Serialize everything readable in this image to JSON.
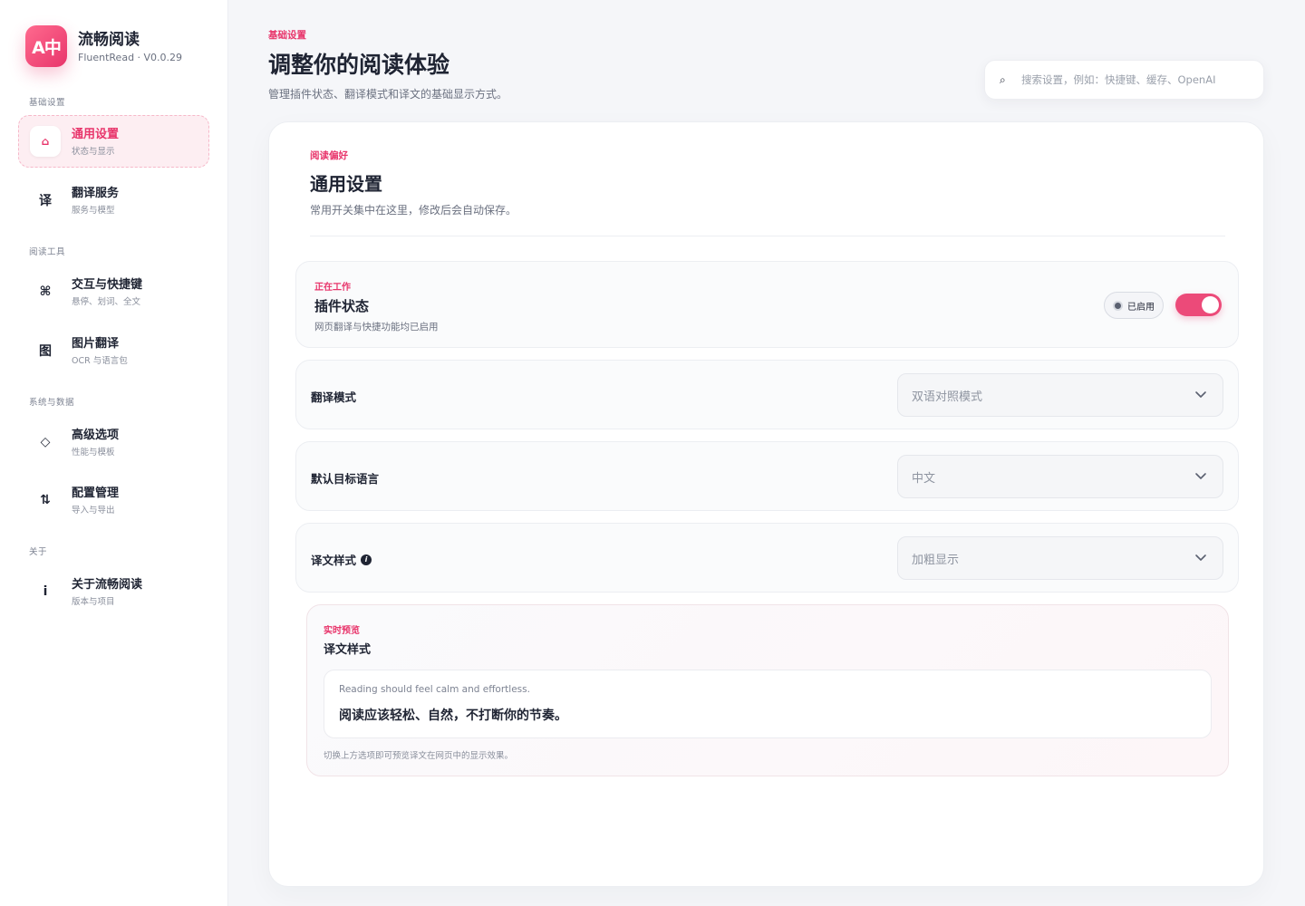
{
  "brand": {
    "name": "流畅阅读",
    "subtitle": "FluentRead · V0.0.29",
    "logo_text": "A中"
  },
  "sidebar": {
    "groups": [
      "基础设置",
      "阅读工具",
      "系统与数据",
      "关于"
    ],
    "items": [
      {
        "title": "通用设置",
        "sub": "状态与显示",
        "icon": "⌂"
      },
      {
        "title": "翻译服务",
        "sub": "服务与模型",
        "icon": "译"
      },
      {
        "title": "交互与快捷键",
        "sub": "悬停、划词、全文",
        "icon": "⌘"
      },
      {
        "title": "图片翻译",
        "sub": "OCR 与语言包",
        "icon": "图"
      },
      {
        "title": "高级选项",
        "sub": "性能与模板",
        "icon": "◇"
      },
      {
        "title": "配置管理",
        "sub": "导入与导出",
        "icon": "⇅"
      },
      {
        "title": "关于流畅阅读",
        "sub": "版本与项目",
        "icon": "i"
      }
    ]
  },
  "header": {
    "eyebrow": "基础设置",
    "title": "调整你的阅读体验",
    "desc": "管理插件状态、翻译模式和译文的基础显示方式。"
  },
  "search": {
    "placeholder": "搜索设置，例如：快捷键、缓存、OpenAI",
    "icon": "⌕"
  },
  "section": {
    "eyebrow": "阅读偏好",
    "title": "通用设置",
    "desc": "常用开关集中在这里，修改后会自动保存。"
  },
  "status": {
    "eyebrow": "正在工作",
    "title": "插件状态",
    "desc": "网页翻译与快捷功能均已启用",
    "badge": "已启用",
    "enabled": true
  },
  "settings": [
    {
      "label": "翻译模式",
      "value": "双语对照模式"
    },
    {
      "label": "默认目标语言",
      "value": "中文"
    },
    {
      "label": "译文样式",
      "value": "加粗显示",
      "info_icon": "i"
    }
  ],
  "preview": {
    "eyebrow": "实时预览",
    "title": "译文样式",
    "original": "Reading should feel calm and effortless.",
    "translated": "阅读应该轻松、自然，不打断你的节奏。",
    "note": "切换上方选项即可预览译文在网页中的显示效果。"
  },
  "colors": {
    "accent": "#e8356b",
    "toggle": "#ec4a79",
    "background": "#f5f6f9"
  }
}
